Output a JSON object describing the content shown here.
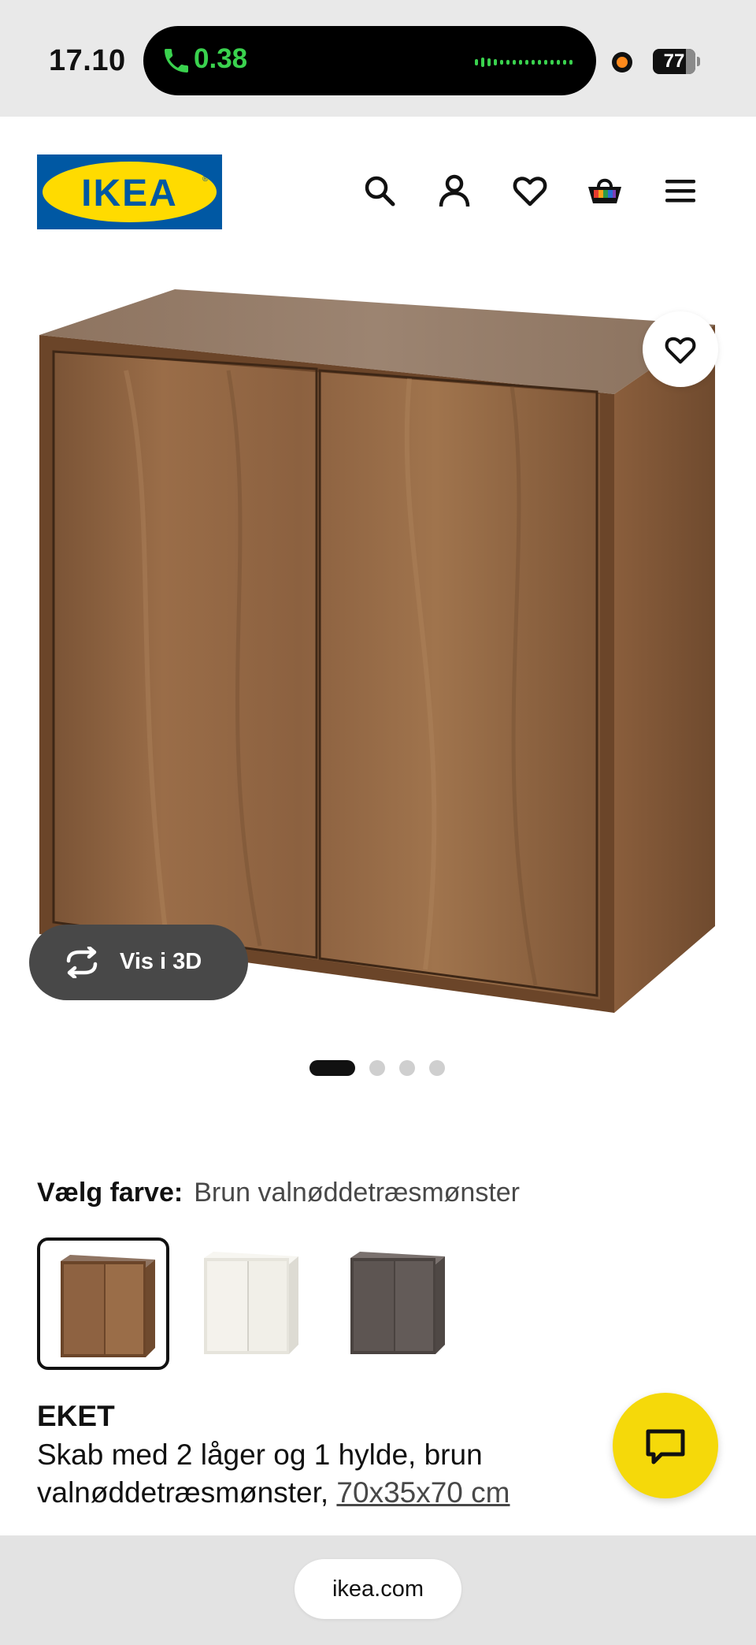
{
  "status_bar": {
    "time": "17.10",
    "call_duration": "0.38",
    "battery_level": "77"
  },
  "header": {
    "logo_text": "IKEA",
    "icons": [
      "search-icon",
      "account-icon",
      "heart-icon",
      "basket-icon",
      "menu-icon"
    ]
  },
  "gallery": {
    "view_3d_label": "Vis i 3D",
    "image_count": 4,
    "active_index": 0
  },
  "color_picker": {
    "label": "Vælg farve:",
    "selected_value": "Brun valnøddetræsmønster",
    "options": [
      {
        "color": "#8a5f3d",
        "selected": true
      },
      {
        "color": "#f4f2ec",
        "selected": false
      },
      {
        "color": "#5d5552",
        "selected": false
      }
    ]
  },
  "product": {
    "name": "EKET",
    "description": "Skab med 2 låger og 1 hylde, brun valnøddetræsmønster,",
    "size_link": "70x35x70 cm"
  },
  "browser": {
    "url": "ikea.com"
  },
  "colors": {
    "ikea_blue": "#0058a3",
    "ikea_yellow": "#ffdb00",
    "chat_yellow": "#f5d90a",
    "call_green": "#3ad24e"
  }
}
